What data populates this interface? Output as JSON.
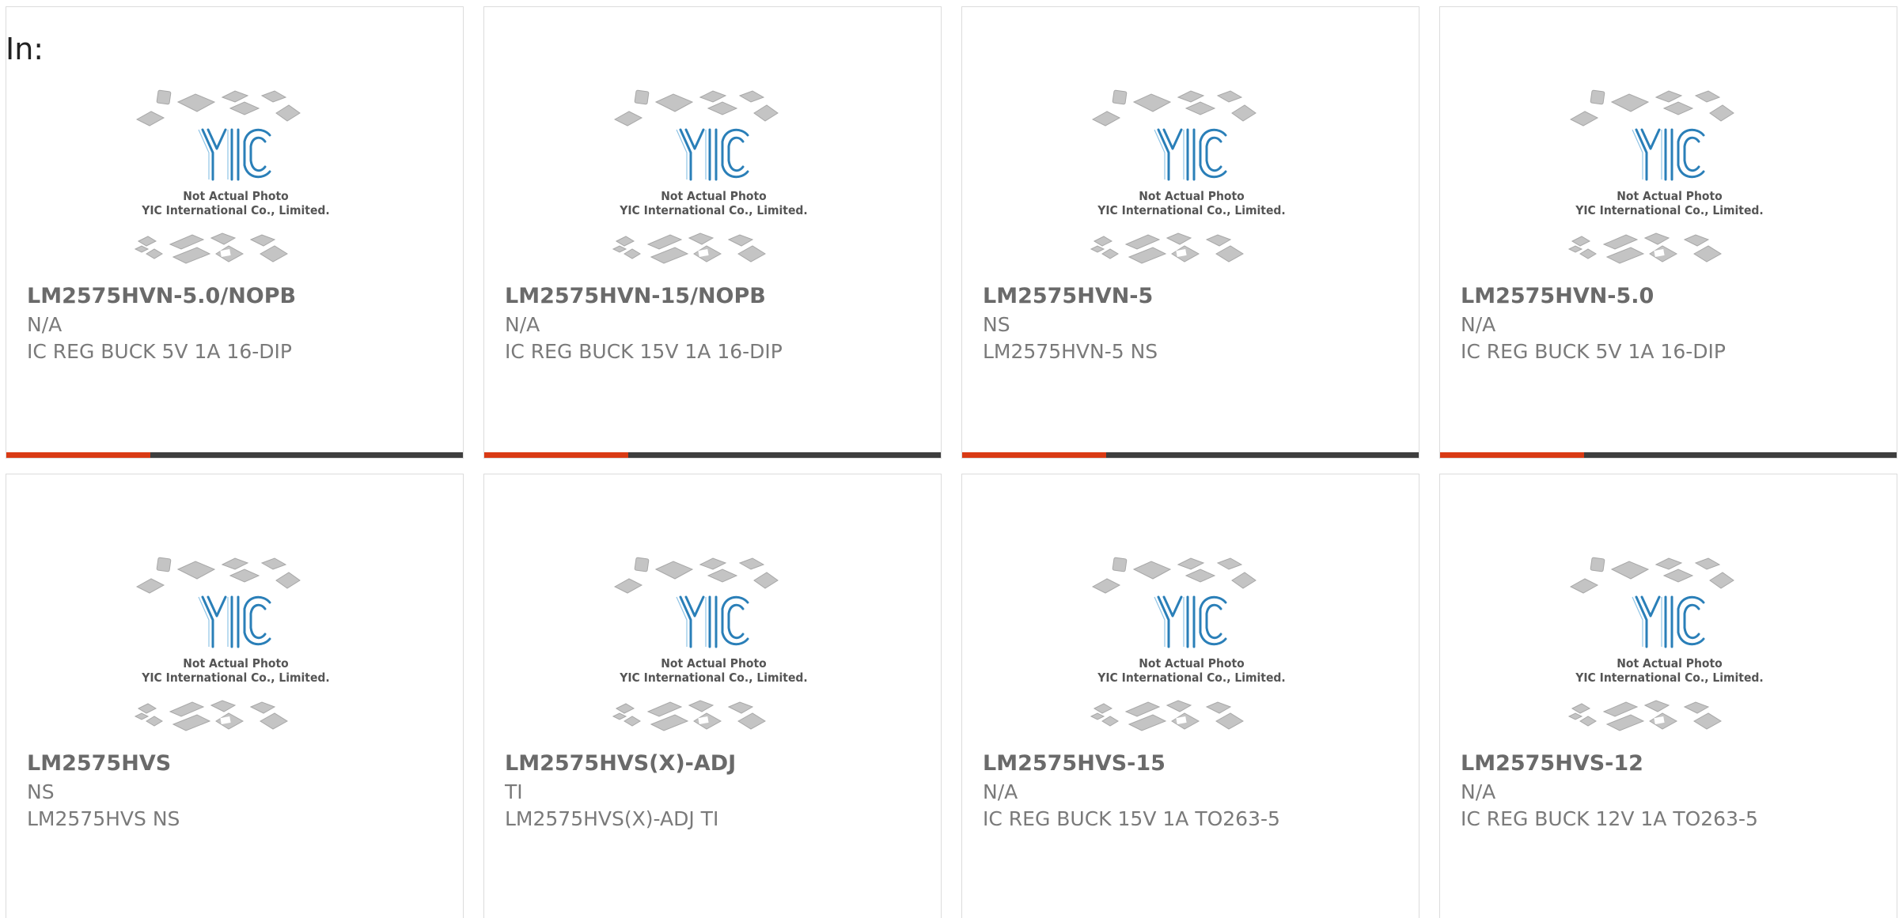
{
  "header": {
    "label": "In:"
  },
  "colors": {
    "accent": "#d93a14",
    "bar": "#3e3e3e",
    "logo": "#2a7fb8"
  },
  "photo": {
    "logo_text": "YIC",
    "caption_line1": "Not Actual Photo",
    "caption_line2": "YIC International Co., Limited."
  },
  "products": [
    {
      "part": "LM2575HVN-5.0/NOPB",
      "maker": "N/A",
      "desc": "IC REG BUCK 5V 1A 16-DIP"
    },
    {
      "part": "LM2575HVN-15/NOPB",
      "maker": "N/A",
      "desc": "IC REG BUCK 15V 1A 16-DIP"
    },
    {
      "part": "LM2575HVN-5",
      "maker": "NS",
      "desc": "LM2575HVN-5 NS"
    },
    {
      "part": "LM2575HVN-5.0",
      "maker": "N/A",
      "desc": "IC REG BUCK 5V 1A 16-DIP"
    },
    {
      "part": "LM2575HVS",
      "maker": "NS",
      "desc": "LM2575HVS NS"
    },
    {
      "part": "LM2575HVS(X)-ADJ",
      "maker": "TI",
      "desc": "LM2575HVS(X)-ADJ TI"
    },
    {
      "part": "LM2575HVS-15",
      "maker": "N/A",
      "desc": "IC REG BUCK 15V 1A TO263-5"
    },
    {
      "part": "LM2575HVS-12",
      "maker": "N/A",
      "desc": "IC REG BUCK 12V 1A TO263-5"
    }
  ]
}
